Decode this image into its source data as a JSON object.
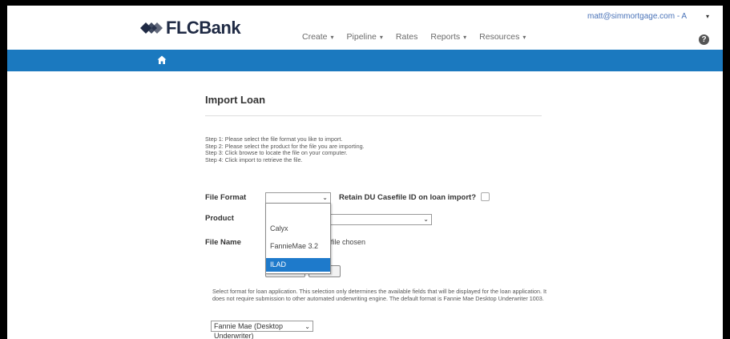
{
  "header": {
    "logo_text": "FLCBank",
    "nav": [
      {
        "label": "Create",
        "caret": "▾"
      },
      {
        "label": "Pipeline",
        "caret": "▾"
      },
      {
        "label": "Rates",
        "caret": ""
      },
      {
        "label": "Reports",
        "caret": "▾"
      },
      {
        "label": "Resources",
        "caret": "▾"
      }
    ],
    "user_email": "matt@simmortgage.com - A",
    "user_caret": "▾",
    "help_glyph": "?"
  },
  "colors": {
    "accent_bar": "#1b79bf",
    "dropdown_selected": "#1e7acb",
    "link": "#4a73b8"
  },
  "main": {
    "title": "Import Loan",
    "steps": [
      "Step 1: Please select the file format you like to import.",
      "Step 2: Please select the product for the file you are importing.",
      "Step 3: Click browse to locate the file on your computer.",
      "Step 4: Click import to retrieve the file."
    ],
    "file_format_label": "File Format",
    "file_format_value": "",
    "retain_label": "Retain DU Casefile ID on loan import?",
    "product_label": "Product",
    "product_value": "",
    "file_name_label": "File Name",
    "file_status": "file chosen",
    "cancel_label": "ncel",
    "dropdown_options": [
      "Calyx",
      "FannieMae 3.2",
      "ILAD"
    ],
    "dropdown_selected": "ILAD",
    "format_note": "Select format for loan application. This selection only determines the available fields that will be displayed for the loan application. It does not require submission to other automated underwriting engine. The default format is Fannie Mae Desktop Underwriter 1003.",
    "app_format_value": "Fannie Mae (Desktop Underwriter)"
  }
}
